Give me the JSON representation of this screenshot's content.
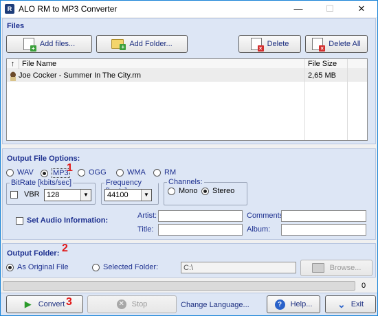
{
  "window": {
    "title": "ALO RM to MP3 Converter",
    "app_icon_letter": "R",
    "controls": {
      "minimize": "—",
      "maximize": "☐",
      "close": "✕"
    }
  },
  "files": {
    "section_title": "Files",
    "add_files_label": "Add files...",
    "add_folder_label": "Add Folder...",
    "delete_label": "Delete",
    "delete_all_label": "Delete All",
    "columns": {
      "sort": "↑",
      "name": "File Name",
      "size": "File Size"
    },
    "rows": [
      {
        "name": "Joe Cocker - Summer In The City.rm",
        "size": "2,65 MB"
      }
    ]
  },
  "output_options": {
    "section_title": "Output File Options:",
    "formats": [
      "WAV",
      "MP3",
      "OGG",
      "WMA",
      "RM"
    ],
    "selected_format": "MP3",
    "bitrate_group": "BitRate [kbits/sec]",
    "vbr_label": "VBR",
    "vbr_checked": false,
    "bitrate_value": "128",
    "frequency_group": "Frequency [hertz]:",
    "frequency_value": "44100",
    "channels_group": "Channels:",
    "channel_mono": "Mono",
    "channel_stereo": "Stereo",
    "selected_channel": "Stereo",
    "set_audio_info_label": "Set Audio Information:",
    "set_audio_info_checked": false,
    "artist_label": "Artist:",
    "title_label": "Title:",
    "comments_label": "Comments:",
    "album_label": "Album:",
    "artist_value": "",
    "title_value": "",
    "comments_value": "",
    "album_value": ""
  },
  "output_folder": {
    "section_title": "Output Folder:",
    "as_original_label": "As Original File",
    "selected_folder_label": "Selected Folder:",
    "selected_mode": "As Original File",
    "folder_path": "C:\\",
    "browse_label": "Browse..."
  },
  "progress": {
    "percent": 0,
    "count_text": "0"
  },
  "footer": {
    "convert_label": "Convert",
    "stop_label": "Stop",
    "change_language_label": "Change Language...",
    "help_label": "Help...",
    "exit_label": "Exit"
  },
  "annotations": [
    "1",
    "2",
    "3"
  ],
  "colors": {
    "section_bg": "#dde6f5",
    "section_title": "#1c2f8f",
    "annotation_red": "#e01818",
    "titlebar_border": "#1883d7"
  }
}
